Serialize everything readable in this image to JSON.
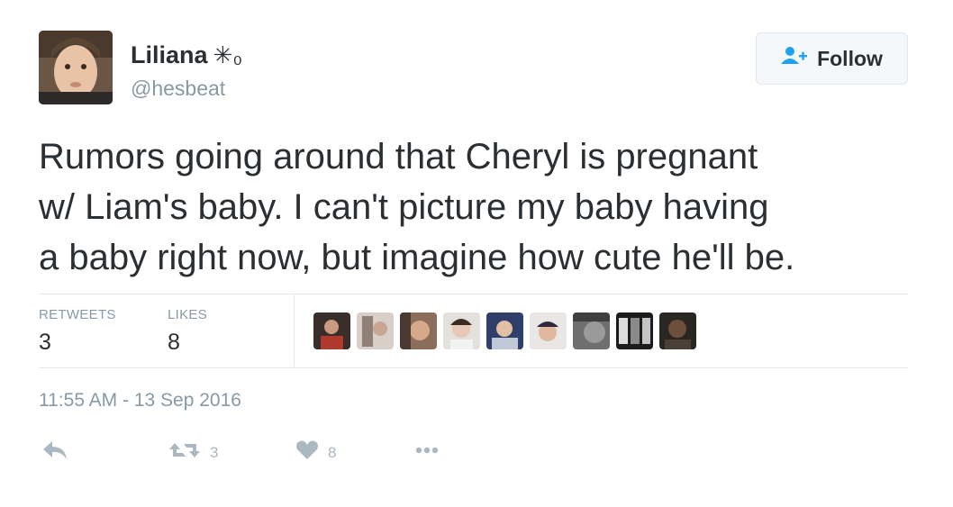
{
  "user": {
    "name": "Liliana",
    "name_symbol": "✳₀",
    "handle": "@hesbeat"
  },
  "follow_button": {
    "label": "Follow",
    "icon": "add-user-icon"
  },
  "tweet": {
    "lines": [
      "Rumors going around that Cheryl is pregnant",
      "w/ Liam's baby. I can't picture my baby having",
      "a baby right now, but imagine how cute he'll be."
    ]
  },
  "stats": {
    "retweets_label": "RETWEETS",
    "retweets_value": "3",
    "likes_label": "LIKES",
    "likes_value": "8"
  },
  "liked_by_avatars": [
    "avatar-1",
    "avatar-2",
    "avatar-3",
    "avatar-4",
    "avatar-5",
    "avatar-6",
    "avatar-7",
    "avatar-8",
    "avatar-9"
  ],
  "timestamp": "11:55 AM - 13 Sep 2016",
  "actions": {
    "reply_icon": "reply-icon",
    "retweet_icon": "retweet-icon",
    "retweet_count": "3",
    "like_icon": "heart-icon",
    "like_count": "8",
    "more_icon": "more-icon"
  },
  "colors": {
    "text": "#292f33",
    "muted": "#8899a6",
    "action": "#aab8c2",
    "border": "#e1e8ed"
  }
}
